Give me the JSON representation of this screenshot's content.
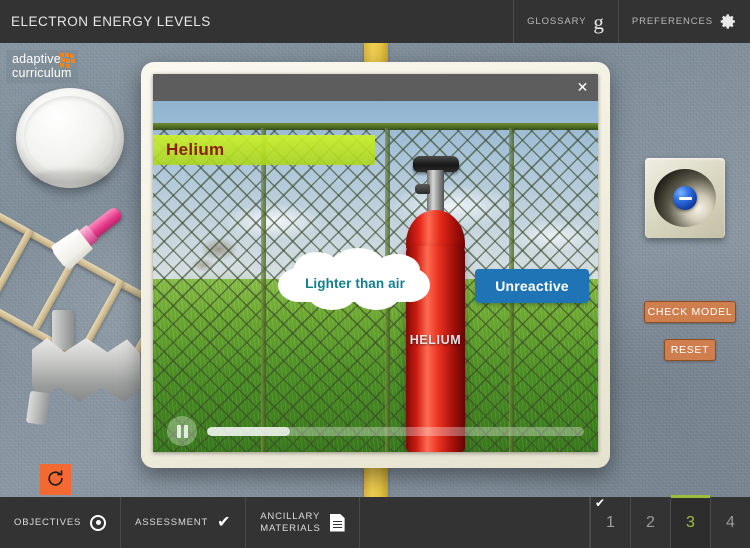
{
  "header": {
    "title": "ELECTRON ENERGY LEVELS",
    "glossary_label": "GLOSSARY",
    "glossary_icon": "glossary-g-icon",
    "preferences_label": "PREFERENCES",
    "preferences_icon": "gear-icon"
  },
  "logo": {
    "line1": "adaptive",
    "line2": "curriculum",
    "accent_color": "#f0851f"
  },
  "sidebar": {
    "reset_icon": "refresh-circular-arrow-icon",
    "electron_tile": {
      "name": "electron-token",
      "symbol": "−",
      "color": "#2f6fe0"
    },
    "check_model_label": "CHECK MODEL",
    "reset_label": "RESET",
    "button_color": "#cf7f4e"
  },
  "modal": {
    "close_icon": "close-icon",
    "close_label": "✕",
    "video": {
      "banner_title": "Helium",
      "banner_color": "#cdf229",
      "banner_text_color": "#8c1d10",
      "callouts": [
        {
          "name": "cloud-callout",
          "text": "Lighter than air",
          "text_color": "#137f8e",
          "shape": "cloud"
        },
        {
          "name": "blue-callout",
          "text": "Unreactive",
          "text_color": "#ffffff",
          "shape": "rounded-box",
          "bg_color": "#1f74b6"
        }
      ],
      "tank_label": "HELIUM",
      "tank_color": "#e8301e"
    },
    "player": {
      "pause_icon": "pause-icon",
      "progress_percent": 22
    }
  },
  "footer": {
    "buttons": [
      {
        "label": "OBJECTIVES",
        "icon": "target-icon"
      },
      {
        "label": "ASSESSMENT",
        "icon": "check-icon"
      },
      {
        "label_line1": "ANCILLARY",
        "label_line2": "MATERIALS",
        "icon": "document-icon"
      }
    ],
    "pages": [
      {
        "number": "1",
        "active": false,
        "completed": true
      },
      {
        "number": "2",
        "active": false,
        "completed": false
      },
      {
        "number": "3",
        "active": true,
        "completed": false
      },
      {
        "number": "4",
        "active": false,
        "completed": false
      }
    ],
    "active_color": "#9bbf3c",
    "completed_icon": "check-icon"
  }
}
